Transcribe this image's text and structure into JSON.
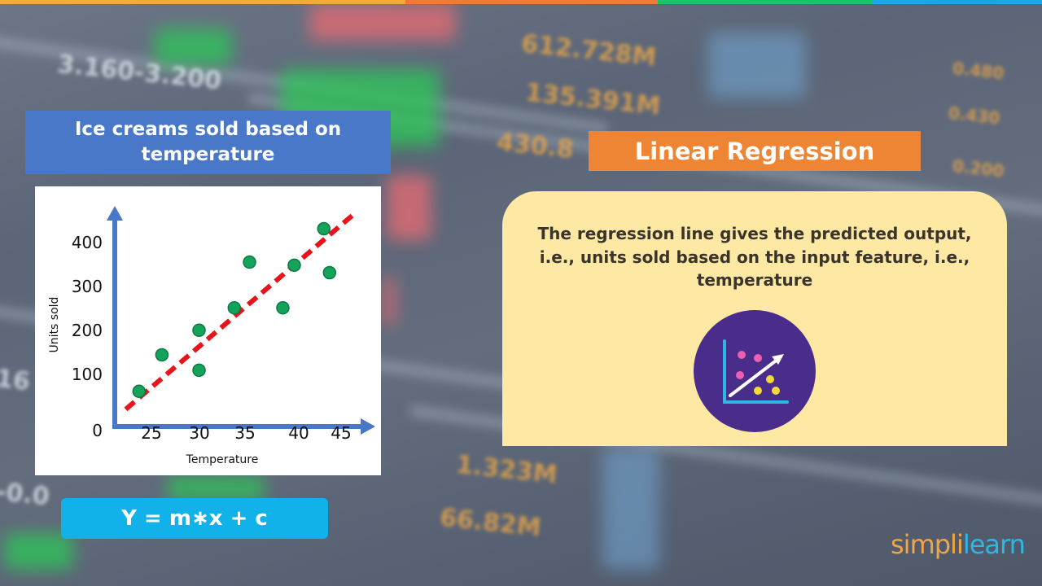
{
  "top_bar_colors": [
    "#f2ac35",
    "#ee7c34",
    "#18c46a",
    "#16a8de"
  ],
  "left_panel": {
    "title": "Ice creams sold based on temperature",
    "formula": "Y = m∗x + c"
  },
  "right_panel": {
    "title": "Linear Regression",
    "description": "The regression line gives the predicted output, i.e., units sold based on the input feature, i.e., temperature",
    "icon": "scatter-trend-chart-icon"
  },
  "logo": {
    "part1": "simpl",
    "part2": "i",
    "part3": "learn"
  },
  "colors": {
    "title_blue": "#4a78c8",
    "formula_blue": "#11b1ea",
    "orange": "#ee8535",
    "card_yellow": "#fde9a4",
    "axis_blue": "#4a78c8",
    "point_green": "#14a35a",
    "line_red": "#e8141b",
    "icon_purple": "#4a2c8a"
  },
  "chart_data": {
    "type": "scatter",
    "title": "Ice creams sold based on temperature",
    "xlabel": "Temperature",
    "ylabel": "Units sold",
    "x_ticks": [
      25,
      30,
      35,
      40,
      45
    ],
    "y_ticks": [
      0,
      100,
      200,
      300,
      400
    ],
    "xlim": [
      21.5,
      47.5
    ],
    "ylim": [
      0,
      480
    ],
    "grid": false,
    "points": [
      {
        "x": 23.7,
        "y": 80
      },
      {
        "x": 26.1,
        "y": 163
      },
      {
        "x": 30.0,
        "y": 219
      },
      {
        "x": 30.0,
        "y": 128
      },
      {
        "x": 33.7,
        "y": 270
      },
      {
        "x": 35.3,
        "y": 374
      },
      {
        "x": 38.8,
        "y": 270
      },
      {
        "x": 40.0,
        "y": 367
      },
      {
        "x": 43.1,
        "y": 450
      },
      {
        "x": 43.7,
        "y": 350
      }
    ],
    "regression_line": {
      "x": [
        22.3,
        46.3
      ],
      "y": [
        39,
        484
      ],
      "style": "dashed"
    }
  }
}
